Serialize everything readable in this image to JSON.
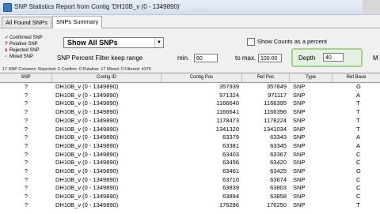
{
  "window": {
    "title": "SNP Statistics Report from Contig 'DH10B_v (0 - 1349890)'"
  },
  "tabs": [
    {
      "label": "All Found SNPs"
    },
    {
      "label": "SNPs Summary"
    }
  ],
  "legend": [
    {
      "mark": "✓",
      "label": "Confirmed SNP"
    },
    {
      "mark": "?",
      "label": "Putative SNP"
    },
    {
      "mark": "x",
      "label": "Rejected SNP"
    },
    {
      "mark": "-",
      "label": "Mixed SNP"
    }
  ],
  "filter": {
    "select_value": "Show All SNPs",
    "show_percent_label": "Show Counts as a percent",
    "percent_filter_label": "SNP Percent Filter  keep range",
    "min_label": "min.",
    "min_value": "60",
    "max_label": "to max.",
    "max_value": "100.00",
    "depth_label": "Depth",
    "depth_value": "40",
    "cut_label": "M"
  },
  "summary": "17 SNP Columns: Rejected: 0 Confirm: 0 Putative: 17 Mixed: 0 Filtered: 4376",
  "table": {
    "headers": [
      "SNP",
      "Contig ID",
      "Contig Pos",
      "Ref Pos",
      "Type",
      "Ref Base"
    ],
    "rows": [
      [
        "?",
        "DH10B_v (0 - 1349890)",
        "357939",
        "357849",
        "SNP",
        "G"
      ],
      [
        "?",
        "DH10B_v (0 - 1349890)",
        "971324",
        "971117",
        "SNP",
        "A"
      ],
      [
        "?",
        "DH10B_v (0 - 1349890)",
        "1166640",
        "1166395",
        "SNP",
        "T"
      ],
      [
        "?",
        "DH10B_v (0 - 1349890)",
        "1166641",
        "1166396",
        "SNP",
        "T"
      ],
      [
        "?",
        "DH10B_v (0 - 1349890)",
        "1178473",
        "1178224",
        "SNP",
        "T"
      ],
      [
        "?",
        "DH10B_v (0 - 1349890)",
        "1341320",
        "1341034",
        "SNP",
        "T"
      ],
      [
        "?",
        "DH10B_v (0 - 1349890)",
        "63379",
        "63343",
        "SNP",
        "A"
      ],
      [
        "?",
        "DH10B_v (0 - 1349890)",
        "63381",
        "63345",
        "SNP",
        "A"
      ],
      [
        "?",
        "DH10B_v (0 - 1349890)",
        "63403",
        "63367",
        "SNP",
        "C"
      ],
      [
        "?",
        "DH10B_v (0 - 1349890)",
        "63456",
        "63420",
        "SNP",
        "C"
      ],
      [
        "?",
        "DH10B_v (0 - 1349890)",
        "63461",
        "63425",
        "SNP",
        "G"
      ],
      [
        "?",
        "DH10B_v (0 - 1349890)",
        "63710",
        "63674",
        "SNP",
        "C"
      ],
      [
        "?",
        "DH10B_v (0 - 1349890)",
        "63839",
        "63803",
        "SNP",
        "C"
      ],
      [
        "?",
        "DH10B_v (0 - 1349890)",
        "63894",
        "63858",
        "SNP",
        "C"
      ],
      [
        "?",
        "DH10B_v (0 - 1349890)",
        "176286",
        "176250",
        "SNP",
        "T"
      ]
    ]
  }
}
